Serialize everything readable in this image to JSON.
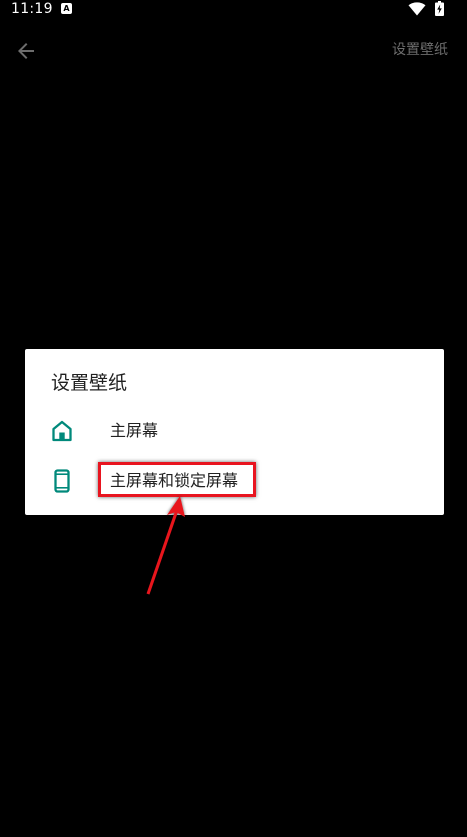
{
  "status_bar": {
    "time": "11:19",
    "notification_icon_letter": "A",
    "icons": [
      "wifi-icon",
      "battery-charging-icon"
    ]
  },
  "app_bar": {
    "back_icon": "arrow-left-icon",
    "title": "设置壁纸"
  },
  "dialog": {
    "title": "设置壁纸",
    "options": [
      {
        "label": "主屏幕",
        "icon": "home-icon"
      },
      {
        "label": "主屏幕和锁定屏幕",
        "icon": "phone-icon"
      }
    ]
  },
  "annotation": {
    "highlight_color": "#e8141f",
    "highlighted_option_index": 1
  },
  "colors": {
    "background": "#000000",
    "icon_accent": "#00897b",
    "dialog_bg": "#ffffff"
  }
}
